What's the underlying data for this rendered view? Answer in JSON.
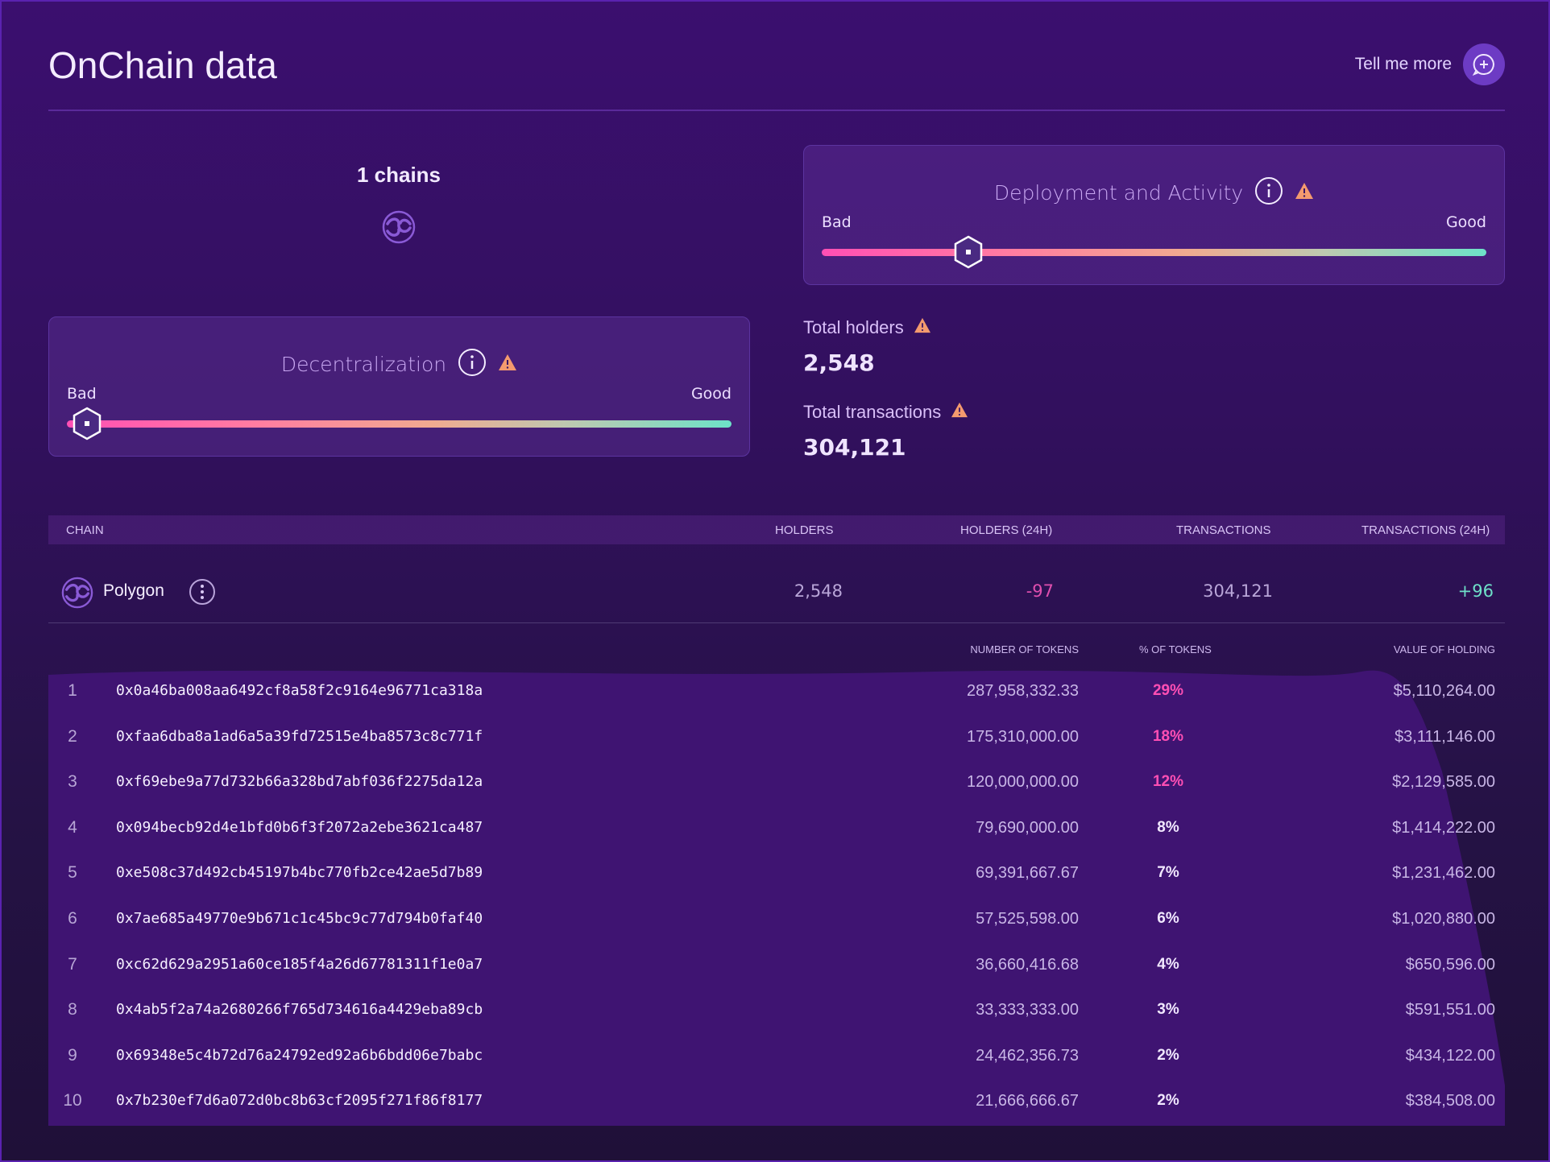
{
  "header": {
    "title": "OnChain data",
    "tell_more_label": "Tell me more"
  },
  "chains": {
    "count_label": "1 chains",
    "logo_icon": "polygon-icon"
  },
  "deployment": {
    "title": "Deployment and Activity",
    "bad_label": "Bad",
    "good_label": "Good",
    "level": 0.22
  },
  "decentralization": {
    "title": "Decentralization",
    "bad_label": "Bad",
    "good_label": "Good",
    "level": 0.03
  },
  "stats": {
    "holders_label": "Total holders",
    "holders_value": "2,548",
    "transactions_label": "Total transactions",
    "transactions_value": "304,121"
  },
  "chain_table": {
    "headers": {
      "chain": "CHAIN",
      "holders": "HOLDERS",
      "holders_24h": "HOLDERS (24H)",
      "transactions": "TRANSACTIONS",
      "transactions_24h": "TRANSACTIONS (24H)"
    },
    "row": {
      "name": "Polygon",
      "holders": "2,548",
      "holders_24h": "-97",
      "transactions": "304,121",
      "transactions_24h": "+96"
    }
  },
  "token_table": {
    "headers": {
      "number": "NUMBER OF TOKENS",
      "percent": "% OF TOKENS",
      "value": "VALUE OF HOLDING"
    },
    "rows": [
      {
        "rank": "1",
        "address": "0x0a46ba008aa6492cf8a58f2c9164e96771ca318a",
        "tokens": "287,958,332.33",
        "percent": "29%",
        "value": "$5,110,264.00",
        "highlight": true
      },
      {
        "rank": "2",
        "address": "0xfaa6dba8a1ad6a5a39fd72515e4ba8573c8c771f",
        "tokens": "175,310,000.00",
        "percent": "18%",
        "value": "$3,111,146.00",
        "highlight": true
      },
      {
        "rank": "3",
        "address": "0xf69ebe9a77d732b66a328bd7abf036f2275da12a",
        "tokens": "120,000,000.00",
        "percent": "12%",
        "value": "$2,129,585.00",
        "highlight": true
      },
      {
        "rank": "4",
        "address": "0x094becb92d4e1bfd0b6f3f2072a2ebe3621ca487",
        "tokens": "79,690,000.00",
        "percent": "8%",
        "value": "$1,414,222.00",
        "highlight": false
      },
      {
        "rank": "5",
        "address": "0xe508c37d492cb45197b4bc770fb2ce42ae5d7b89",
        "tokens": "69,391,667.67",
        "percent": "7%",
        "value": "$1,231,462.00",
        "highlight": false
      },
      {
        "rank": "6",
        "address": "0x7ae685a49770e9b671c1c45bc9c77d794b0faf40",
        "tokens": "57,525,598.00",
        "percent": "6%",
        "value": "$1,020,880.00",
        "highlight": false
      },
      {
        "rank": "7",
        "address": "0xc62d629a2951a60ce185f4a26d67781311f1e0a7",
        "tokens": "36,660,416.68",
        "percent": "4%",
        "value": "$650,596.00",
        "highlight": false
      },
      {
        "rank": "8",
        "address": "0x4ab5f2a74a2680266f765d734616a4429eba89cb",
        "tokens": "33,333,333.00",
        "percent": "3%",
        "value": "$591,551.00",
        "highlight": false
      },
      {
        "rank": "9",
        "address": "0x69348e5c4b72d76a24792ed92a6b6bdd06e7babc",
        "tokens": "24,462,356.73",
        "percent": "2%",
        "value": "$434,122.00",
        "highlight": false
      },
      {
        "rank": "10",
        "address": "0x7b230ef7d6a072d0bc8b63cf2095f271f86f8177",
        "tokens": "21,666,666.67",
        "percent": "2%",
        "value": "$384,508.00",
        "highlight": false
      }
    ]
  },
  "colors": {
    "negative": "#e04fae",
    "positive": "#6ee0c8",
    "highlight_pct": "#ff4fb4",
    "normal_pct": "#f1e8ff",
    "warning": "#f49a6e",
    "accent": "#6d3bc4"
  }
}
